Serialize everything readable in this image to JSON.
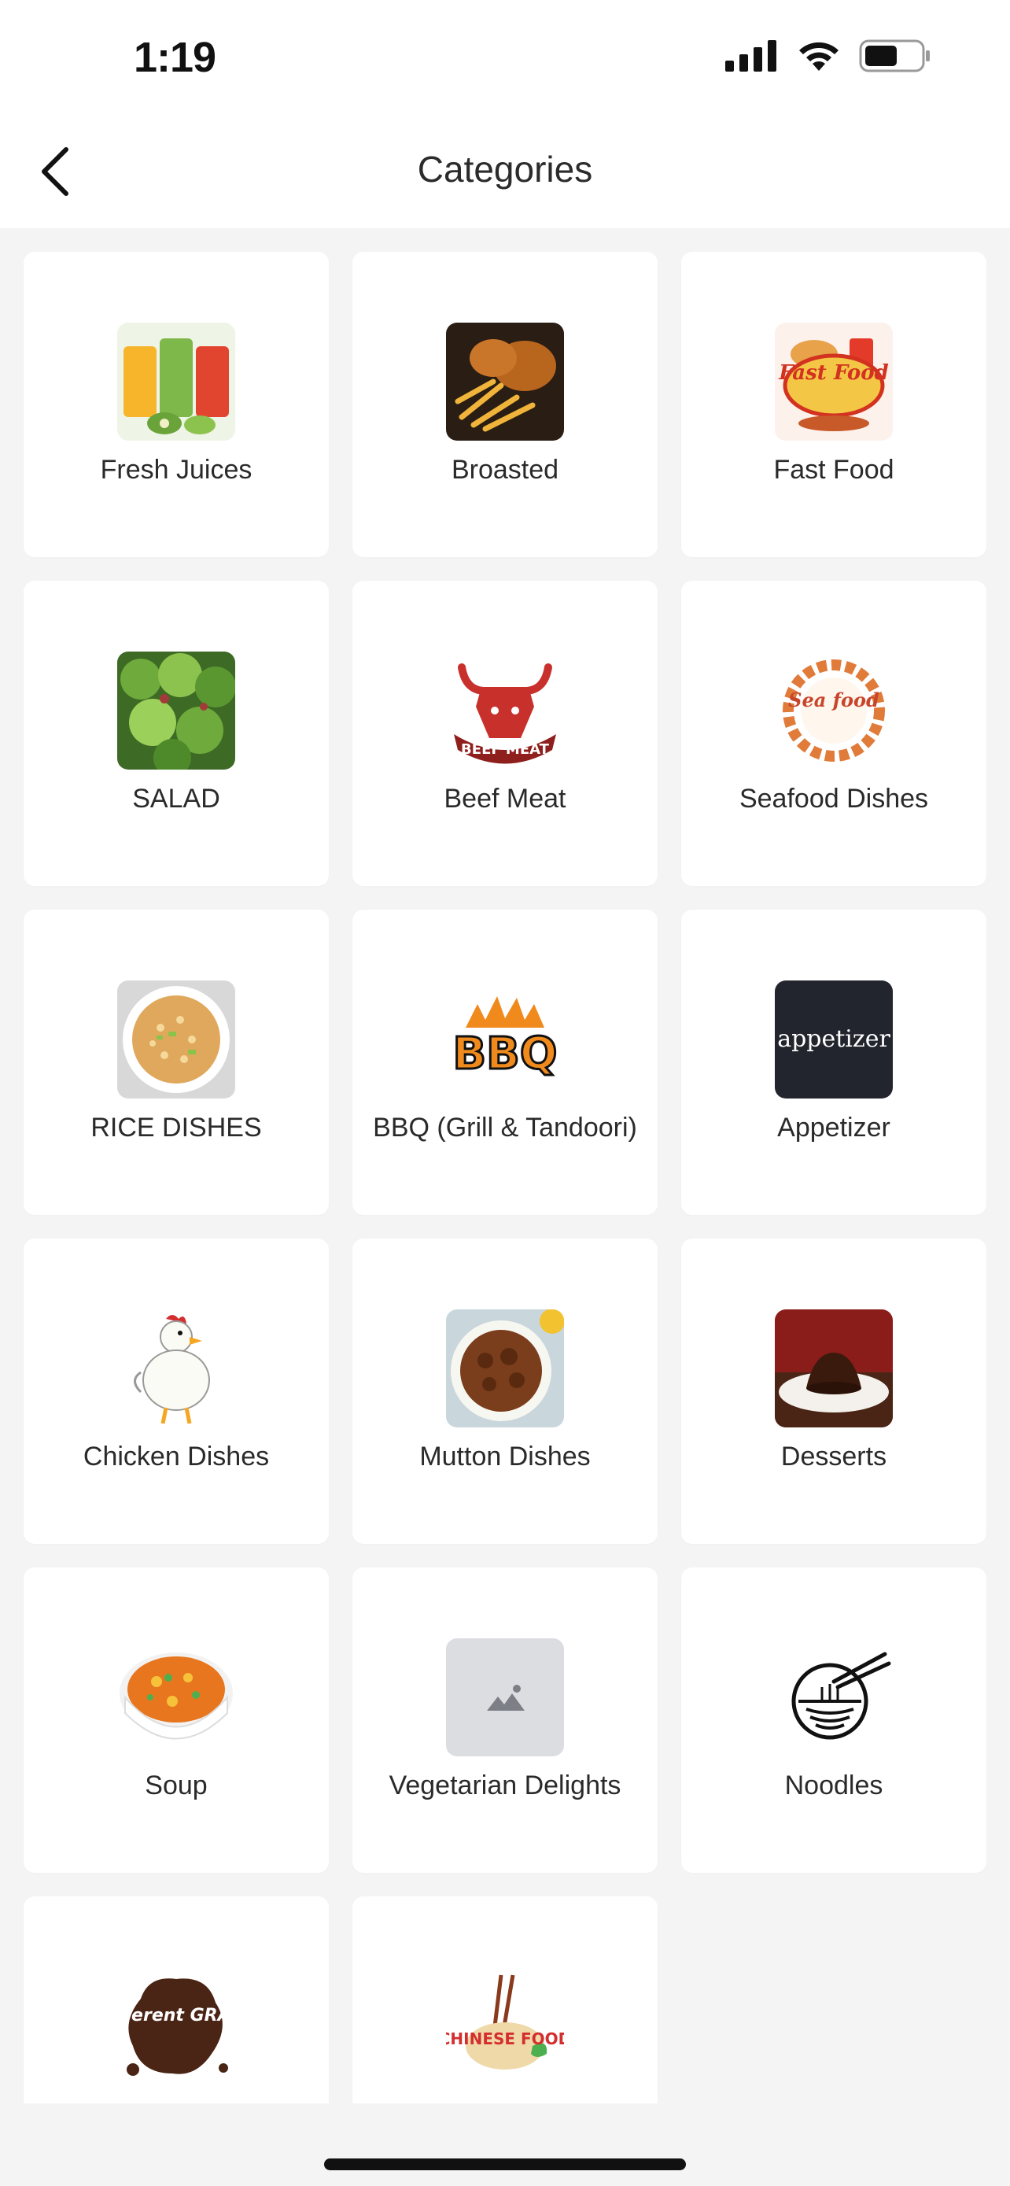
{
  "status": {
    "time": "1:19"
  },
  "header": {
    "title": "Categories"
  },
  "categories": [
    {
      "label": "Fresh Juices",
      "icon": "fresh-juices-icon"
    },
    {
      "label": "Broasted",
      "icon": "broasted-icon"
    },
    {
      "label": "Fast Food",
      "icon": "fast-food-icon",
      "logo_text": "Fast Food"
    },
    {
      "label": "SALAD",
      "icon": "salad-icon"
    },
    {
      "label": "Beef Meat",
      "icon": "beef-meat-icon",
      "logo_text": "BEEF MEAT"
    },
    {
      "label": "Seafood Dishes",
      "icon": "seafood-icon",
      "logo_text": "Sea food"
    },
    {
      "label": "RICE DISHES",
      "icon": "rice-icon"
    },
    {
      "label": "BBQ (Grill & Tandoori)",
      "icon": "bbq-icon",
      "logo_text": "BBQ"
    },
    {
      "label": "Appetizer",
      "icon": "appetizer-icon",
      "logo_text": "appetizer"
    },
    {
      "label": "Chicken Dishes",
      "icon": "chicken-icon"
    },
    {
      "label": "Mutton Dishes",
      "icon": "mutton-icon"
    },
    {
      "label": "Desserts",
      "icon": "desserts-icon"
    },
    {
      "label": "Soup",
      "icon": "soup-icon"
    },
    {
      "label": "Vegetarian Delights",
      "icon": "image-placeholder-icon"
    },
    {
      "label": "Noodles",
      "icon": "noodles-icon"
    },
    {
      "label": "",
      "icon": "different-gravy-icon",
      "logo_text": "Different GRAVY"
    },
    {
      "label": "",
      "icon": "chinese-food-icon",
      "logo_text": "CHINESE FOOD"
    }
  ]
}
